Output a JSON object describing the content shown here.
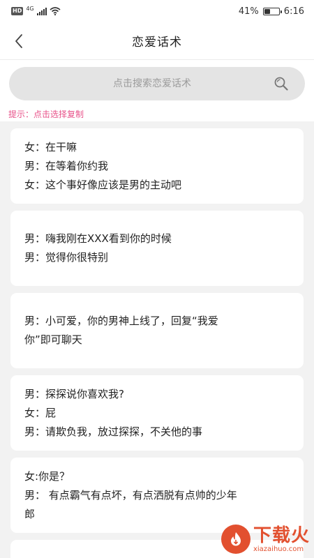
{
  "status_bar": {
    "hd": "HD",
    "network": "4G",
    "battery": "41%",
    "battery_level": 0.41,
    "time": "6:16"
  },
  "header": {
    "title": "恋爱话术",
    "back_icon": "chevron-left-icon"
  },
  "search": {
    "placeholder": "点击搜索恋爱话术",
    "value": "",
    "icon": "search-icon"
  },
  "hint": "提示：点击选择复制",
  "cards": [
    {
      "lines": [
        "女：在干嘛",
        "男：在等着你约我",
        "女：这个事好像应该是男的主动吧"
      ]
    },
    {
      "lines": [
        "男：嗨我刚在XXX看到你的时候",
        "男：觉得你很特别"
      ]
    },
    {
      "lines": [
        "男：小可爱，你的男神上线了，回复“我爱",
        "你”即可聊天"
      ]
    },
    {
      "lines": [
        "男：探探说你喜欢我?",
        "女：屁",
        "男：请欺负我，放过探探，不关他的事"
      ]
    },
    {
      "lines": [
        "女:你是？",
        "男： 有点霸气有点坏，有点洒脱有点帅的少年",
        "郎"
      ]
    }
  ],
  "watermark": {
    "title": "下载火",
    "subtitle": "xiazaihuo.com"
  },
  "colors": {
    "hint": "#e8528a",
    "background": "#f2f2f2",
    "card": "#ffffff",
    "watermark": "#e2502f"
  }
}
